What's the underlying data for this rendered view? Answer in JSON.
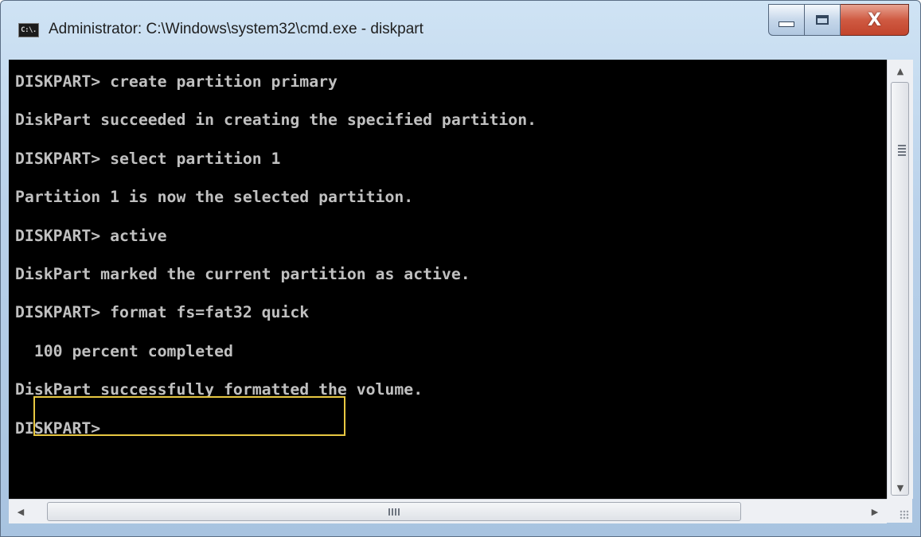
{
  "window": {
    "title": "Administrator: C:\\Windows\\system32\\cmd.exe - diskpart",
    "icon_label": "C:\\."
  },
  "controls": {
    "minimize_icon": "minimize-icon",
    "maximize_icon": "maximize-icon",
    "close_glyph": "X"
  },
  "console": {
    "lines": [
      "DISKPART> create partition primary",
      "DiskPart succeeded in creating the specified partition.",
      "DISKPART> select partition 1",
      "Partition 1 is now the selected partition.",
      "DISKPART> active",
      "DiskPart marked the current partition as active.",
      "DISKPART> format fs=fat32 quick",
      "  100 percent completed",
      "DiskPart successfully formatted the volume.",
      "DISKPART>"
    ]
  },
  "colors": {
    "console_bg": "#000000",
    "console_text": "#c0c0c0",
    "highlight_border": "#e8c842"
  },
  "scrollbar": {
    "up_glyph": "▲",
    "down_glyph": "▼",
    "left_glyph": "◀",
    "right_glyph": "▶"
  }
}
